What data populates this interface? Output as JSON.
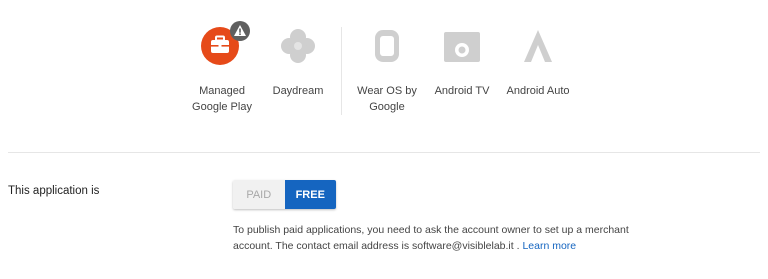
{
  "devices": [
    {
      "label_line1": "Managed",
      "label_line2": "Google Play",
      "icon": "briefcase-icon",
      "badge_icon": "warning-icon"
    },
    {
      "label_line1": "Daydream",
      "label_line2": "",
      "icon": "daydream-icon"
    },
    {
      "label_line1": "Wear OS by",
      "label_line2": "Google",
      "icon": "watch-icon"
    },
    {
      "label_line1": "Android TV",
      "label_line2": "",
      "icon": "tv-icon"
    },
    {
      "label_line1": "Android Auto",
      "label_line2": "",
      "icon": "auto-icon"
    }
  ],
  "pricing": {
    "label": "This application is",
    "options": [
      "PAID",
      "FREE"
    ],
    "selected": "FREE",
    "help_text_1": "To publish paid applications, you need to ask the account owner to set up a merchant",
    "help_text_2": "account. The contact email address is software@visiblelab.it . ",
    "learn_more": "Learn more"
  },
  "colors": {
    "accent": "#1565c0",
    "managed_red": "#e64a19",
    "disabled_gray": "#c9c9c9"
  }
}
